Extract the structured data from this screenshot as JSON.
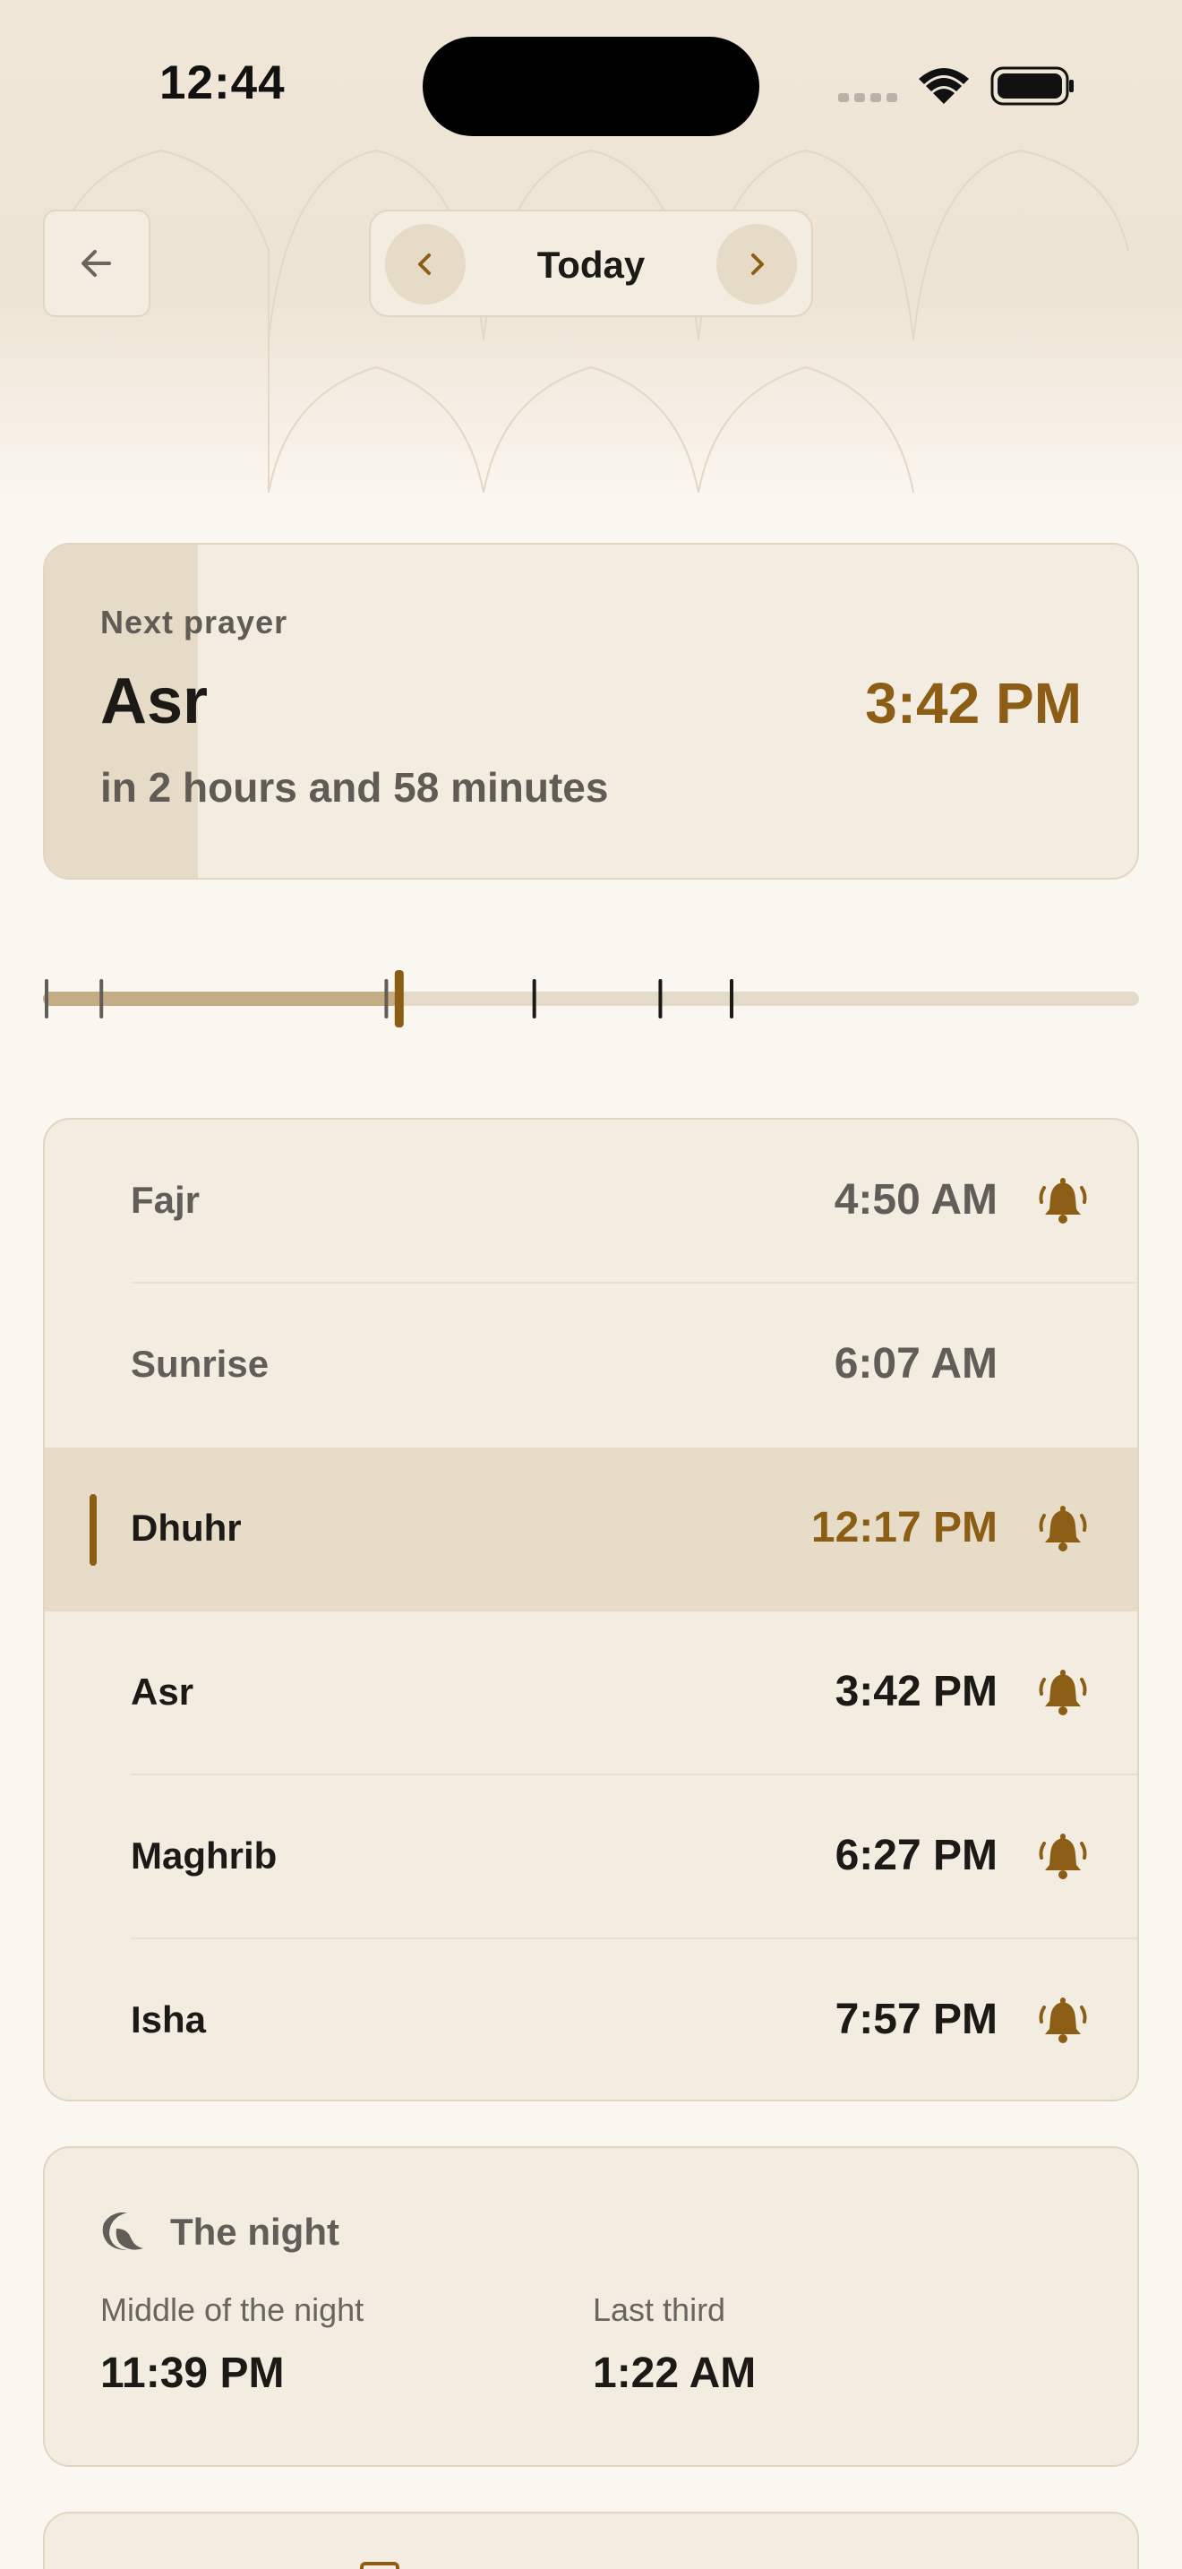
{
  "status_bar": {
    "time": "12:44"
  },
  "header": {
    "day_label": "Today"
  },
  "next_prayer": {
    "label": "Next prayer",
    "name": "Asr",
    "time": "3:42 PM",
    "relative": "in 2 hours and 58 minutes",
    "elapsed_fraction": 0.14
  },
  "prayers": [
    {
      "name": "Fajr",
      "time": "4:50 AM",
      "bell": true,
      "state": "past"
    },
    {
      "name": "Sunrise",
      "time": "6:07 AM",
      "bell": false,
      "state": "past"
    },
    {
      "name": "Dhuhr",
      "time": "12:17 PM",
      "bell": true,
      "state": "current"
    },
    {
      "name": "Asr",
      "time": "3:42 PM",
      "bell": true,
      "state": "upcoming"
    },
    {
      "name": "Maghrib",
      "time": "6:27 PM",
      "bell": true,
      "state": "upcoming"
    },
    {
      "name": "Isha",
      "time": "7:57 PM",
      "bell": true,
      "state": "upcoming"
    }
  ],
  "timeline": {
    "current_position_fraction": 0.325,
    "marker_fractions": [
      0.0,
      0.05,
      0.31,
      0.445,
      0.56,
      0.625
    ]
  },
  "night": {
    "title": "The night",
    "middle_label": "Middle of the night",
    "middle_time": "11:39 PM",
    "last_third_label": "Last third",
    "last_third_time": "1:22 AM"
  },
  "colors": {
    "accent": "#8c5e15",
    "card": "#f3ece1",
    "active_row": "#e6dcc7",
    "background": "#faf6f0"
  }
}
